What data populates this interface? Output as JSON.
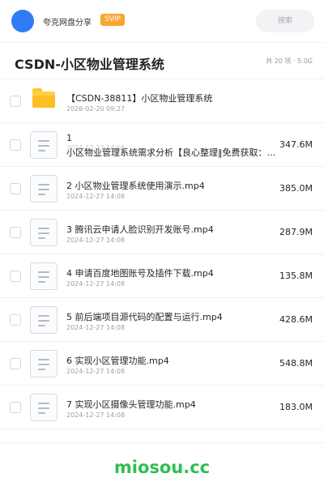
{
  "topbar": {
    "share_name": "夸克网盘分享",
    "badge": "SVIP",
    "search_placeholder": "搜索"
  },
  "header": {
    "title": "CSDN-小区物业管理系统",
    "summary": "共 20 项 · 5.0G"
  },
  "files": [
    {
      "type": "folder",
      "name": "【CSDN-38811】小区物业管理系统",
      "date": "2026-02-20 09:27",
      "size": ""
    },
    {
      "type": "file",
      "name": "1",
      "name_line2": "小区物业管理系统需求分析【良心整理‖免费获取：…",
      "date": "2024-12-27 14:08",
      "size": "347.6M"
    },
    {
      "type": "file",
      "name": "2 小区物业管理系统使用演示.mp4",
      "date": "2024-12-27 14:08",
      "size": "385.0M"
    },
    {
      "type": "file",
      "name": "3 腾讯云申请人脸识别开发账号.mp4",
      "date": "2024-12-27 14:08",
      "size": "287.9M"
    },
    {
      "type": "file",
      "name": "4 申请百度地图账号及插件下载.mp4",
      "date": "2024-12-27 14:08",
      "size": "135.8M"
    },
    {
      "type": "file",
      "name": "5 前后端项目源代码的配置与运行.mp4",
      "date": "2024-12-27 14:08",
      "size": "428.6M"
    },
    {
      "type": "file",
      "name": "6 实现小区管理功能.mp4",
      "date": "2024-12-27 14:08",
      "size": "548.8M"
    },
    {
      "type": "file",
      "name": "7 实现小区摄像头管理功能.mp4",
      "date": "2024-12-27 14:08",
      "size": "183.0M"
    }
  ],
  "watermark": "miosou.cc",
  "colors": {
    "avatar": "#2f7cf6",
    "svip_badge": "#f7a630",
    "folder": "#ffcf40",
    "watermark": "#2fbf52"
  }
}
